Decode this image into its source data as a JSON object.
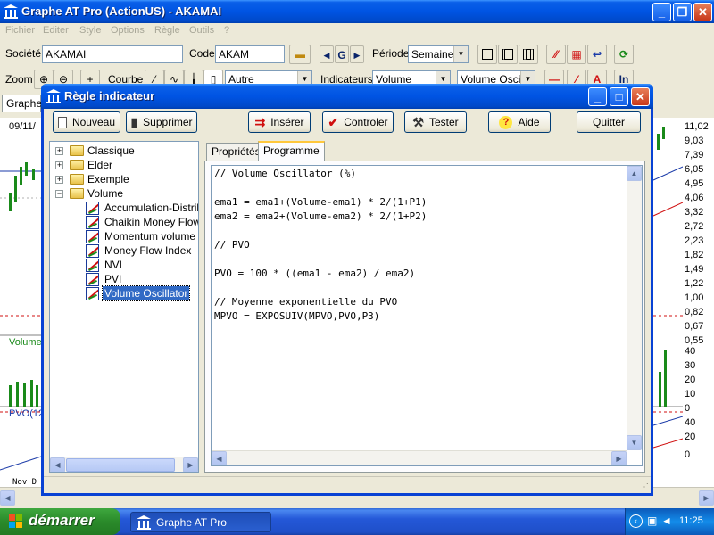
{
  "app": {
    "title": "Graphe AT Pro (ActionUS) - AKAMAI",
    "menu": [
      "Fichier",
      "Editer",
      "Style",
      "Options",
      "Règle",
      "Outils",
      "?"
    ]
  },
  "toolbar": {
    "societe_label": "Société",
    "societe_value": "AKAMAI",
    "code_label": "Code",
    "code_value": "AKAM",
    "periode_label": "Période",
    "periode_value": "Semaine",
    "zoom_label": "Zoom",
    "courbe_label": "Courbe",
    "courbe_value": "Autre",
    "indicateurs_label": "Indicateurs",
    "indicateurs_value": "Volume",
    "indicator_value": "Volume Oscillat",
    "nav_g": "G",
    "tab_partial": "Graphe"
  },
  "chart": {
    "date_label": "09/11/",
    "volume_label": "Volume",
    "pvo_label": "PVO(12",
    "bottom_label": "Nov D",
    "scale_price": [
      "11,02",
      "9,03",
      "7,39",
      "6,05",
      "4,95",
      "4,06",
      "3,32",
      "2,72",
      "2,23",
      "1,82",
      "1,49",
      "1,22",
      "1,00",
      "0,82",
      "0,67",
      "0,55"
    ],
    "scale_volume": [
      "40",
      "30",
      "20",
      "10",
      "0"
    ],
    "scale_pvo": [
      "40",
      "20",
      "0"
    ]
  },
  "dialog": {
    "title": "Règle indicateur",
    "buttons": {
      "nouveau": "Nouveau",
      "supprimer": "Supprimer",
      "inserer": "Insérer",
      "controler": "Controler",
      "tester": "Tester",
      "aide": "Aide",
      "quitter": "Quitter"
    },
    "tree": {
      "folders": [
        "Classique",
        "Elder",
        "Exemple",
        "Volume"
      ],
      "volume_items": [
        "Accumulation-Distributi",
        "Chaikin Money Flow",
        "Momentum volume",
        "Money Flow Index",
        "NVI",
        "PVI",
        "Volume Oscillator"
      ],
      "selected": "Volume Oscillator"
    },
    "tabs": [
      "Propriétés",
      "Programme"
    ],
    "active_tab": "Programme",
    "code": [
      "// Volume Oscillator (%)",
      "",
      "ema1 = ema1+(Volume-ema1) * 2/(1+P1)",
      "ema2 = ema2+(Volume-ema2) * 2/(1+P2)",
      "",
      "// PVO",
      "",
      "PVO = 100 * ((ema1 - ema2) / ema2)",
      "",
      "// Moyenne exponentielle du PVO",
      "MPVO = EXPOSUIV(MPVO,PVO,P3)"
    ]
  },
  "taskbar": {
    "start": "démarrer",
    "task": "Graphe AT Pro",
    "time": "11:25"
  }
}
